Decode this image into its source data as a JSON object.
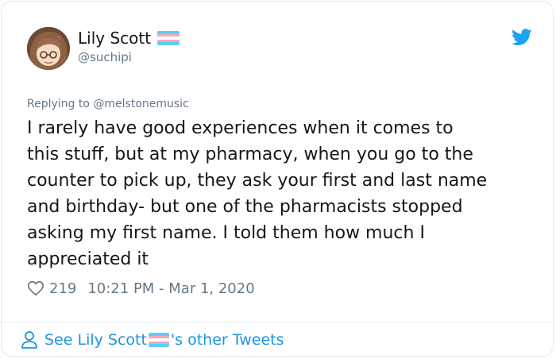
{
  "colors": {
    "text_primary": "#14171a",
    "text_secondary": "#657786",
    "link_blue": "#1b95e0",
    "twitter_blue": "#1da1f2",
    "border": "#e1e8ed",
    "flag_blue": "#5bcefa",
    "flag_pink": "#f5a9b8",
    "flag_white": "#ffffff"
  },
  "author": {
    "display_name": "Lily Scott",
    "handle": "@suchipi",
    "avatar_icon": "avatar-icon",
    "flag_icon": "trans-flag-icon"
  },
  "header": {
    "brand_icon": "twitter-bird-icon"
  },
  "tweet": {
    "reply_prefix": "Replying to ",
    "reply_handle": "@melstonemusic",
    "text": "I rarely have good experiences when it comes to\nthis stuff, but at my pharmacy, when you go to the\ncounter to pick up, they ask your first and last name\nand birthday- but one of the pharmacists stopped\nasking my first name. I told them how much I\nappreciated it",
    "likes": "219",
    "timestamp": "10:21 PM - Mar 1, 2020",
    "heart_icon": "heart-icon"
  },
  "footer": {
    "prefix": "See Lily Scott ",
    "suffix": "'s other Tweets",
    "person_icon": "person-icon"
  }
}
